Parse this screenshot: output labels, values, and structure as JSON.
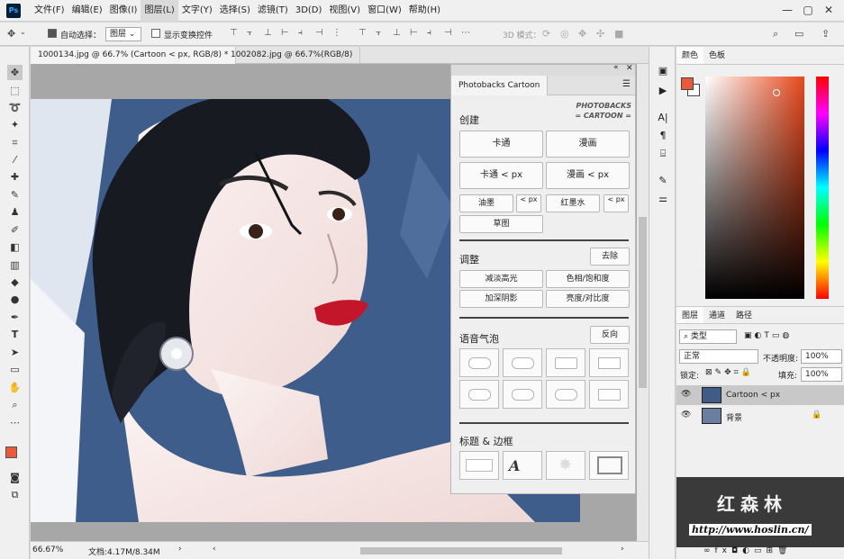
{
  "app": {
    "logo": "Ps"
  },
  "menu": [
    "文件(F)",
    "编辑(E)",
    "图像(I)",
    "图层(L)",
    "文字(Y)",
    "选择(S)",
    "滤镜(T)",
    "3D(D)",
    "视图(V)",
    "窗口(W)",
    "帮助(H)"
  ],
  "window_controls": [
    "—",
    "▢",
    "✕"
  ],
  "options": {
    "auto_select_label": "自动选择：",
    "auto_select_value": "图层",
    "transform_label": "显示变换控件",
    "mode_3d": "3D 模式："
  },
  "doc_tabs": [
    "1000134.jpg @ 66.7% (Cartoon < px, RGB/8) *",
    "1002082.jpg @ 66.7%(RGB/8)"
  ],
  "status": {
    "zoom": "66.67%",
    "doc": "文档:4.17M/8.34M"
  },
  "color_panel": {
    "tabs": [
      "颜色",
      "色板"
    ],
    "fg": "#e85a3a",
    "bg": "#ffffff"
  },
  "layers_panel": {
    "tabs": [
      "图层",
      "通道",
      "路径"
    ],
    "filter_kind": "类型",
    "blend_mode": "正常",
    "opacity_label": "不透明度:",
    "opacity": "100%",
    "lock_label": "锁定:",
    "fill_label": "填充:",
    "fill": "100%",
    "layers": [
      {
        "name": "Cartoon < px",
        "active": true
      },
      {
        "name": "背景",
        "active": false
      }
    ]
  },
  "plugin": {
    "tab": "Photobacks Cartoon",
    "logo_line1": "PHOTOBACKS",
    "logo_line2": "= CARTOON =",
    "create_title": "创建",
    "btn_cartoon": "卡通",
    "btn_comic": "漫画",
    "btn_cartoon_px": "卡通 < px",
    "btn_comic_px": "漫画 < px",
    "btn_oil": "油墨",
    "btn_lt_px": "< px",
    "btn_red_ink": "红墨水",
    "btn_lt_px2": "< px",
    "btn_sketch": "草图",
    "adjust_title": "调整",
    "btn_remove": "去除",
    "btn_dodge": "减淡高光",
    "btn_hue": "色相/饱和度",
    "btn_burn": "加深阴影",
    "btn_bc": "亮度/对比度",
    "bubble_title": "语音气泡",
    "btn_reverse": "反向",
    "frame_title": "标题 & 边框"
  },
  "watermark": {
    "name": "红森林",
    "url": "http://www.hoslin.cn/"
  }
}
